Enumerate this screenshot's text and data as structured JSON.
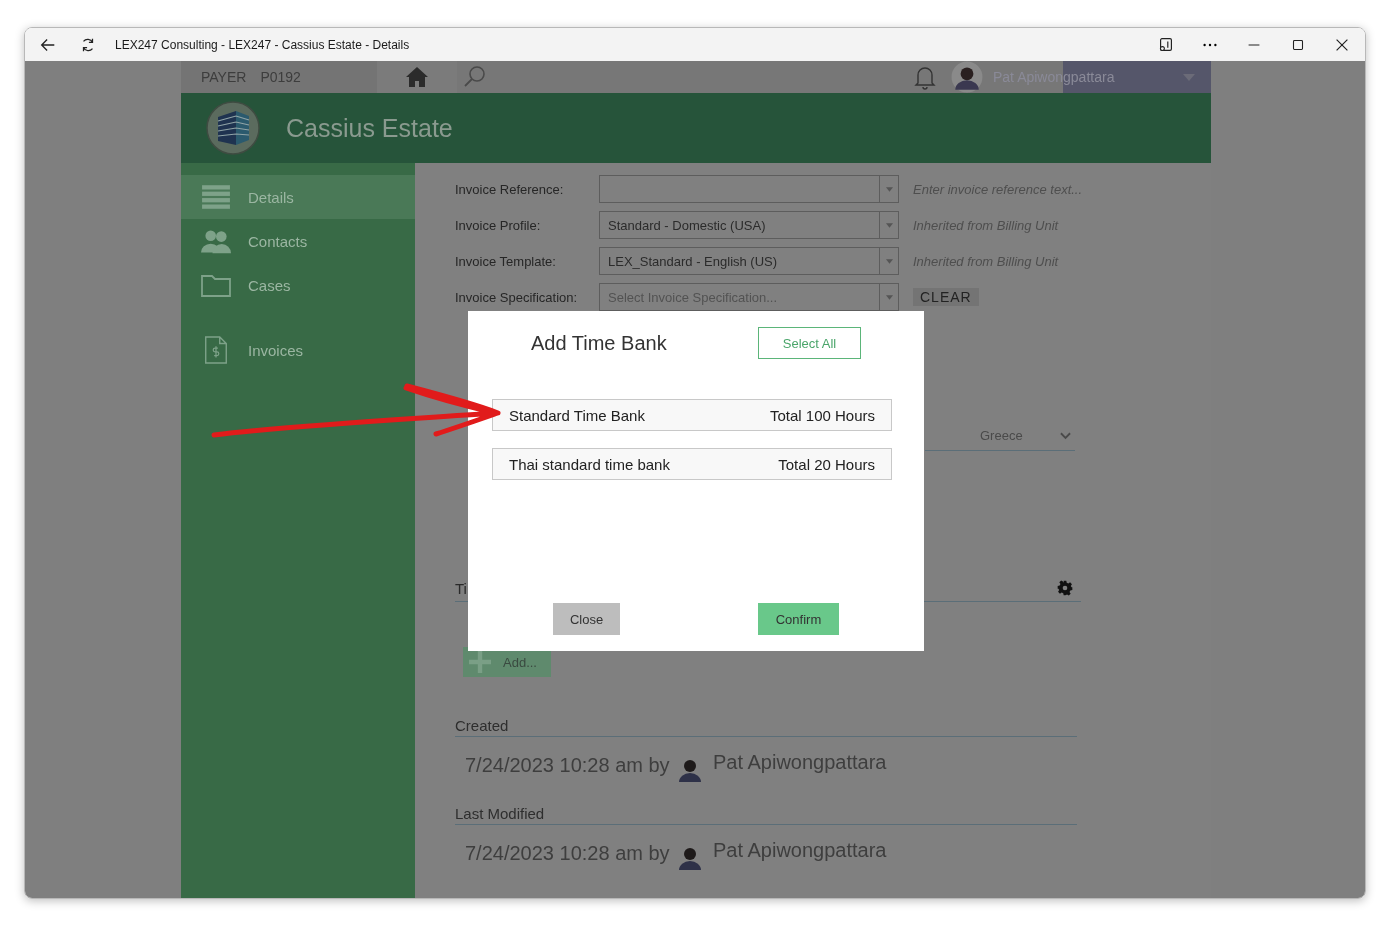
{
  "window": {
    "title": "LEX247 Consulting - LEX247 - Cassius Estate - Details"
  },
  "topbar": {
    "payer_label": "PAYER",
    "payer_id": "P0192",
    "user_name": "Pat Apiwongpattara"
  },
  "header": {
    "title": "Cassius Estate"
  },
  "sidebar": {
    "items": [
      {
        "label": "Details",
        "kind": "list",
        "selected": true
      },
      {
        "label": "Contacts",
        "kind": "people",
        "selected": false
      },
      {
        "label": "Cases",
        "kind": "folder",
        "selected": false
      },
      {
        "label": "Invoices",
        "kind": "invoice",
        "selected": false
      }
    ]
  },
  "form": {
    "fields": [
      {
        "label": "Invoice Reference:",
        "note": "Enter invoice reference text..."
      },
      {
        "label": "Invoice Profile:",
        "value": "Standard - Domestic (USA)",
        "note": "Inherited from Billing Unit"
      },
      {
        "label": "Invoice Template:",
        "value": "LEX_Standard - English (US)",
        "note": "Inherited from Billing Unit"
      },
      {
        "label": "Invoice Specification:",
        "placeholder": "Select Invoice Specification...",
        "action": "CLEAR"
      }
    ]
  },
  "country_select": {
    "value": "Greece"
  },
  "section": {
    "title": "Ti",
    "add_button": "Add..."
  },
  "audit": [
    {
      "heading": "Created",
      "timestamp": "7/24/2023 10:28 am by",
      "user": "Pat Apiwongpattara"
    },
    {
      "heading": "Last Modified",
      "timestamp": "7/24/2023 10:28 am by",
      "user": "Pat Apiwongpattara"
    }
  ],
  "dialog": {
    "title": "Add Time Bank",
    "select_all": "Select All",
    "time_banks": [
      {
        "name": "Standard Time Bank",
        "total": "Total 100 Hours"
      },
      {
        "name": "Thai standard time bank",
        "total": "Total 20 Hours"
      }
    ],
    "buttons": [
      {
        "label": "Close",
        "kind": "secondary"
      },
      {
        "label": "Confirm",
        "kind": "primary"
      }
    ]
  }
}
